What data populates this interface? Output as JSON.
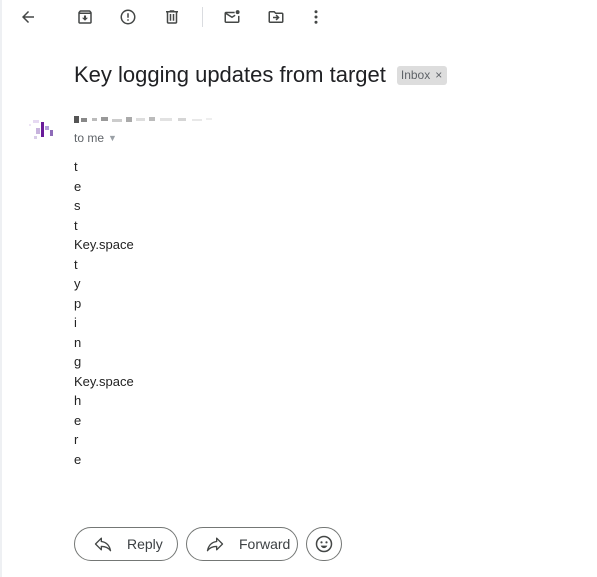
{
  "toolbar": {
    "icons": [
      "back-arrow-icon",
      "archive-icon",
      "report-spam-icon",
      "delete-icon",
      "mark-unread-icon",
      "move-to-icon",
      "more-vert-icon"
    ]
  },
  "message": {
    "subject": "Key logging updates from target",
    "label": "Inbox",
    "label_close": "×",
    "recipient": "to me",
    "body_lines": [
      "t",
      "e",
      "s",
      "t",
      "Key.space",
      "t",
      "y",
      "p",
      "i",
      "n",
      "g",
      "Key.space",
      "h",
      "e",
      "r",
      "e"
    ]
  },
  "actions": {
    "reply_label": "Reply",
    "forward_label": "Forward",
    "emoji_icon": "emoji-icon"
  },
  "colors": {
    "icon": "#444746",
    "text": "#202124",
    "muted": "#5f6368",
    "chip_bg": "#dddddd",
    "button_border": "#747775"
  }
}
